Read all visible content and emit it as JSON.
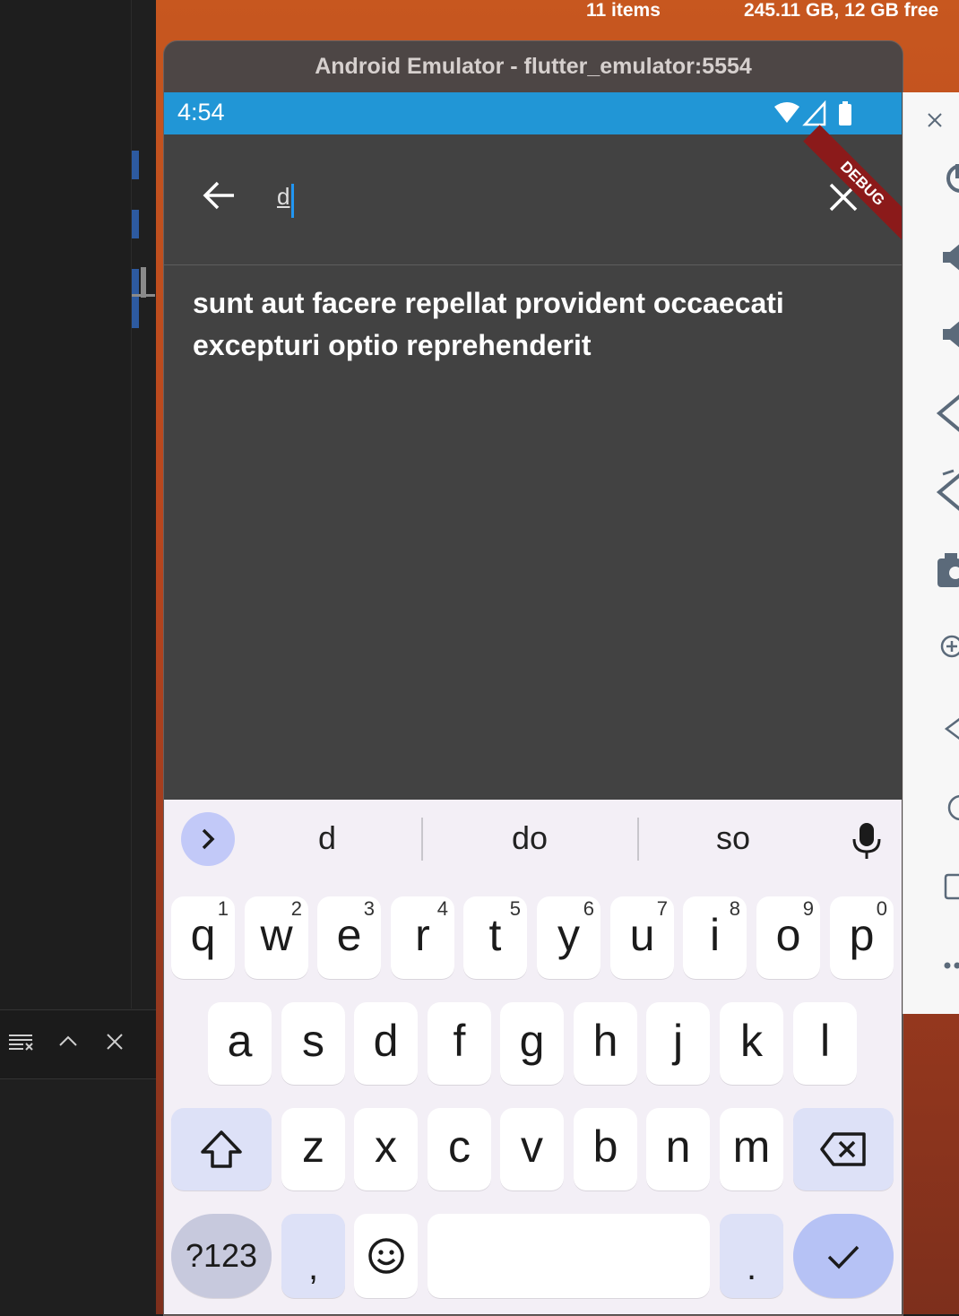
{
  "menubar": {
    "items_count": "11 items",
    "disk_info": "245.11 GB, 12 GB free"
  },
  "window": {
    "title": "Android Emulator - flutter_emulator:5554"
  },
  "status_bar": {
    "time": "4:54"
  },
  "debug_banner": {
    "text": "DEBUG"
  },
  "search": {
    "query": "d"
  },
  "results": [
    "sunt aut facere repellat provident occaecati",
    "excepturi optio reprehenderit"
  ],
  "keyboard": {
    "suggestions": [
      "d",
      "do",
      "so"
    ],
    "row1": [
      {
        "k": "q",
        "n": "1"
      },
      {
        "k": "w",
        "n": "2"
      },
      {
        "k": "e",
        "n": "3"
      },
      {
        "k": "r",
        "n": "4"
      },
      {
        "k": "t",
        "n": "5"
      },
      {
        "k": "y",
        "n": "6"
      },
      {
        "k": "u",
        "n": "7"
      },
      {
        "k": "i",
        "n": "8"
      },
      {
        "k": "o",
        "n": "9"
      },
      {
        "k": "p",
        "n": "0"
      }
    ],
    "row2": [
      "a",
      "s",
      "d",
      "f",
      "g",
      "h",
      "j",
      "k",
      "l"
    ],
    "row3": [
      "z",
      "x",
      "c",
      "v",
      "b",
      "n",
      "m"
    ],
    "symbols_label": "?123",
    "comma": ",",
    "period": "."
  },
  "colors": {
    "status_bar": "#2196d6",
    "app_bg": "#424242",
    "caret": "#2196f3",
    "ribbon": "#8b1a1a"
  }
}
